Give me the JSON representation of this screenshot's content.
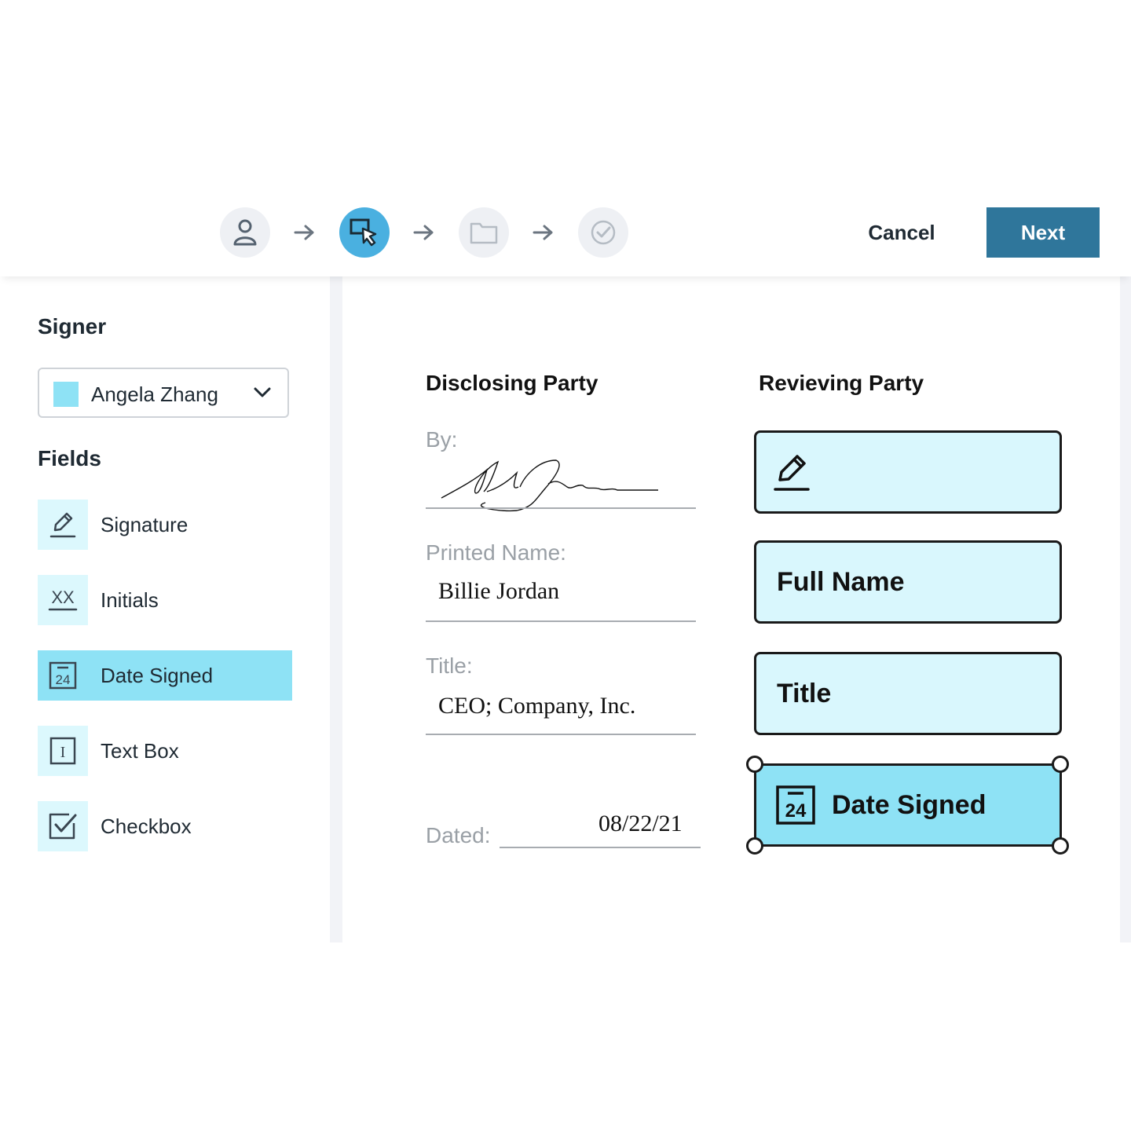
{
  "stepper": {
    "steps": [
      {
        "icon": "person-icon",
        "state": "done"
      },
      {
        "icon": "cursor-select-icon",
        "state": "active"
      },
      {
        "icon": "folder-icon",
        "state": "pending"
      },
      {
        "icon": "check-circle-icon",
        "state": "pending"
      }
    ],
    "active_color": "#4ab0e0"
  },
  "header": {
    "cancel_label": "Cancel",
    "next_label": "Next",
    "next_color": "#2f769b"
  },
  "sidebar": {
    "signer_heading": "Signer",
    "signer": {
      "name": "Angela Zhang",
      "color": "#8ee2f5"
    },
    "fields_heading": "Fields",
    "fields": [
      {
        "label": "Signature",
        "icon": "pen-icon"
      },
      {
        "label": "Initials",
        "icon": "initials-icon",
        "icon_text": "XX"
      },
      {
        "label": "Date Signed",
        "icon": "calendar-icon",
        "icon_text": "24",
        "selected": true
      },
      {
        "label": "Text Box",
        "icon": "text-box-icon",
        "icon_text": "I"
      },
      {
        "label": "Checkbox",
        "icon": "checkbox-icon"
      }
    ]
  },
  "document": {
    "disclosing": {
      "heading": "Disclosing Party",
      "by_label": "By:",
      "printed_name_label": "Printed Name:",
      "printed_name": "Billie Jordan",
      "title_label": "Title:",
      "title_value": "CEO; Company, Inc.",
      "dated_label": "Dated:",
      "dated_value": "08/22/21"
    },
    "receiving": {
      "heading": "Revieving Party",
      "fields": [
        {
          "type": "signature",
          "icon": "pen-icon"
        },
        {
          "label": "Full Name"
        },
        {
          "label": "Title"
        },
        {
          "label": "Date Signed",
          "icon": "calendar-icon",
          "icon_text": "24",
          "selected": true
        }
      ]
    }
  }
}
